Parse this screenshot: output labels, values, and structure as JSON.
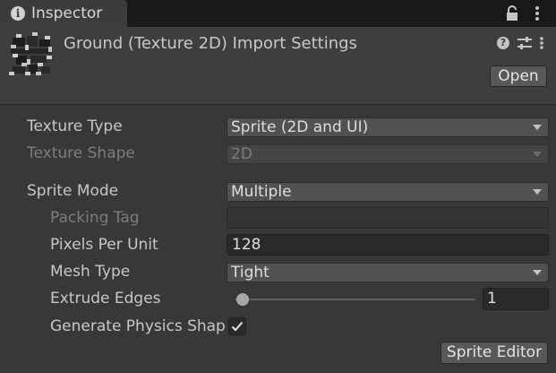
{
  "window": {
    "tab_title": "Inspector",
    "icons": [
      "info-icon",
      "lock-icon",
      "kebab-menu-icon"
    ]
  },
  "asset_header": {
    "title": "Ground (Texture 2D) Import Settings",
    "icons": [
      "texture-asset-icon",
      "help-icon",
      "preset-icon",
      "kebab-menu-icon"
    ],
    "open_button": "Open"
  },
  "fields": {
    "texture_type": {
      "label": "Texture Type",
      "value": "Sprite (2D and UI)"
    },
    "texture_shape": {
      "label": "Texture Shape",
      "value": "2D",
      "disabled": true
    },
    "sprite_mode": {
      "label": "Sprite Mode",
      "value": "Multiple"
    },
    "packing_tag": {
      "label": "Packing Tag",
      "value": "",
      "disabled": true
    },
    "pixels_per_unit": {
      "label": "Pixels Per Unit",
      "value": "128"
    },
    "mesh_type": {
      "label": "Mesh Type",
      "value": "Tight"
    },
    "extrude_edges": {
      "label": "Extrude Edges",
      "value": "1"
    },
    "generate_physics_shape": {
      "label": "Generate Physics Shape",
      "checked": true
    }
  },
  "sprite_editor_button": "Sprite Editor"
}
